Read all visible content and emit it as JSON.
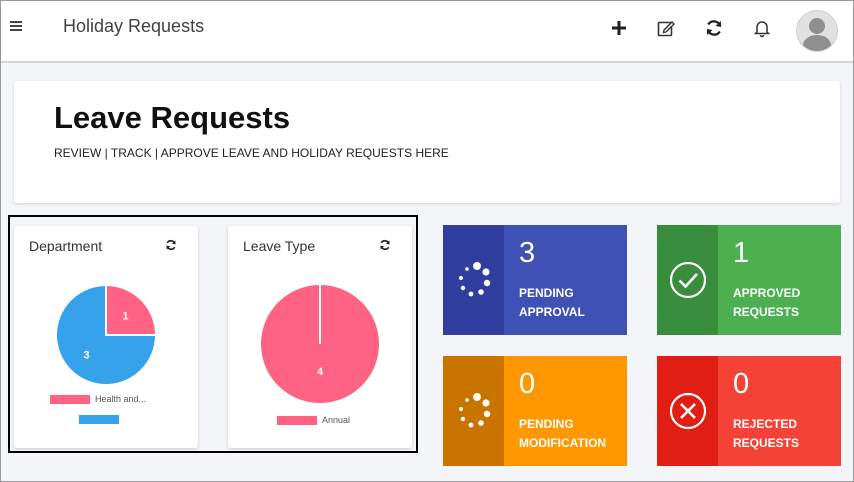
{
  "app": {
    "title": "Holiday Requests"
  },
  "toolbar": {
    "icons": [
      "plus-icon",
      "edit-icon",
      "refresh-icon",
      "bell-icon",
      "avatar"
    ]
  },
  "header": {
    "title": "Leave Requests",
    "subtitle": "REVIEW | TRACK | APPROVE LEAVE AND HOLIDAY REQUESTS HERE"
  },
  "charts": {
    "department": {
      "title": "Department",
      "legend_1": "Health and...",
      "legend_2": ""
    },
    "leave_type": {
      "title": "Leave Type",
      "legend_1": "Annual"
    }
  },
  "chart_data": [
    {
      "type": "pie",
      "title": "Department",
      "slices": [
        {
          "label": "Health and...",
          "value": 1,
          "color": "#ff6384"
        },
        {
          "label": "",
          "value": 3,
          "color": "#36a2eb"
        }
      ]
    },
    {
      "type": "pie",
      "title": "Leave Type",
      "slices": [
        {
          "label": "Annual",
          "value": 4,
          "color": "#ff6384"
        }
      ]
    }
  ],
  "stats": {
    "pending_approval": {
      "value": "3",
      "label_line1": "PENDING",
      "label_line2": "APPROVAL",
      "color": "#3f51b5",
      "icon_bg": "#303f9f"
    },
    "approved": {
      "value": "1",
      "label_line1": "APPROVED",
      "label_line2": "REQUESTS",
      "color": "#4caf50",
      "icon_bg": "#388e3c"
    },
    "pending_modification": {
      "value": "0",
      "label_line1": "PENDING",
      "label_line2": "MODIFICATION",
      "color": "#ff9800",
      "icon_bg": "#ca7400"
    },
    "rejected": {
      "value": "0",
      "label_line1": "REJECTED",
      "label_line2": "REQUESTS",
      "color": "#f44336",
      "icon_bg": "#e01e14"
    }
  }
}
